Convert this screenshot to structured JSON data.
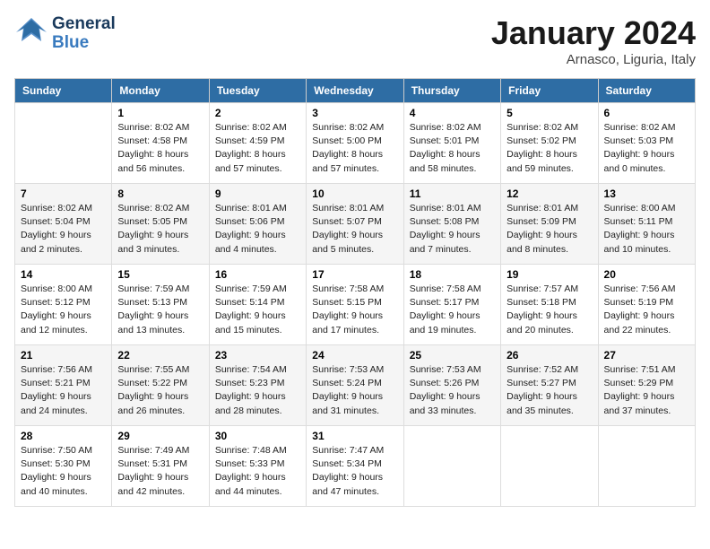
{
  "header": {
    "logo": {
      "general": "General",
      "blue": "Blue"
    },
    "title": "January 2024",
    "subtitle": "Arnasco, Liguria, Italy"
  },
  "columns": [
    "Sunday",
    "Monday",
    "Tuesday",
    "Wednesday",
    "Thursday",
    "Friday",
    "Saturday"
  ],
  "weeks": [
    [
      {
        "day": "",
        "info": ""
      },
      {
        "day": "1",
        "info": "Sunrise: 8:02 AM\nSunset: 4:58 PM\nDaylight: 8 hours\nand 56 minutes."
      },
      {
        "day": "2",
        "info": "Sunrise: 8:02 AM\nSunset: 4:59 PM\nDaylight: 8 hours\nand 57 minutes."
      },
      {
        "day": "3",
        "info": "Sunrise: 8:02 AM\nSunset: 5:00 PM\nDaylight: 8 hours\nand 57 minutes."
      },
      {
        "day": "4",
        "info": "Sunrise: 8:02 AM\nSunset: 5:01 PM\nDaylight: 8 hours\nand 58 minutes."
      },
      {
        "day": "5",
        "info": "Sunrise: 8:02 AM\nSunset: 5:02 PM\nDaylight: 8 hours\nand 59 minutes."
      },
      {
        "day": "6",
        "info": "Sunrise: 8:02 AM\nSunset: 5:03 PM\nDaylight: 9 hours\nand 0 minutes."
      }
    ],
    [
      {
        "day": "7",
        "info": "Sunrise: 8:02 AM\nSunset: 5:04 PM\nDaylight: 9 hours\nand 2 minutes."
      },
      {
        "day": "8",
        "info": "Sunrise: 8:02 AM\nSunset: 5:05 PM\nDaylight: 9 hours\nand 3 minutes."
      },
      {
        "day": "9",
        "info": "Sunrise: 8:01 AM\nSunset: 5:06 PM\nDaylight: 9 hours\nand 4 minutes."
      },
      {
        "day": "10",
        "info": "Sunrise: 8:01 AM\nSunset: 5:07 PM\nDaylight: 9 hours\nand 5 minutes."
      },
      {
        "day": "11",
        "info": "Sunrise: 8:01 AM\nSunset: 5:08 PM\nDaylight: 9 hours\nand 7 minutes."
      },
      {
        "day": "12",
        "info": "Sunrise: 8:01 AM\nSunset: 5:09 PM\nDaylight: 9 hours\nand 8 minutes."
      },
      {
        "day": "13",
        "info": "Sunrise: 8:00 AM\nSunset: 5:11 PM\nDaylight: 9 hours\nand 10 minutes."
      }
    ],
    [
      {
        "day": "14",
        "info": "Sunrise: 8:00 AM\nSunset: 5:12 PM\nDaylight: 9 hours\nand 12 minutes."
      },
      {
        "day": "15",
        "info": "Sunrise: 7:59 AM\nSunset: 5:13 PM\nDaylight: 9 hours\nand 13 minutes."
      },
      {
        "day": "16",
        "info": "Sunrise: 7:59 AM\nSunset: 5:14 PM\nDaylight: 9 hours\nand 15 minutes."
      },
      {
        "day": "17",
        "info": "Sunrise: 7:58 AM\nSunset: 5:15 PM\nDaylight: 9 hours\nand 17 minutes."
      },
      {
        "day": "18",
        "info": "Sunrise: 7:58 AM\nSunset: 5:17 PM\nDaylight: 9 hours\nand 19 minutes."
      },
      {
        "day": "19",
        "info": "Sunrise: 7:57 AM\nSunset: 5:18 PM\nDaylight: 9 hours\nand 20 minutes."
      },
      {
        "day": "20",
        "info": "Sunrise: 7:56 AM\nSunset: 5:19 PM\nDaylight: 9 hours\nand 22 minutes."
      }
    ],
    [
      {
        "day": "21",
        "info": "Sunrise: 7:56 AM\nSunset: 5:21 PM\nDaylight: 9 hours\nand 24 minutes."
      },
      {
        "day": "22",
        "info": "Sunrise: 7:55 AM\nSunset: 5:22 PM\nDaylight: 9 hours\nand 26 minutes."
      },
      {
        "day": "23",
        "info": "Sunrise: 7:54 AM\nSunset: 5:23 PM\nDaylight: 9 hours\nand 28 minutes."
      },
      {
        "day": "24",
        "info": "Sunrise: 7:53 AM\nSunset: 5:24 PM\nDaylight: 9 hours\nand 31 minutes."
      },
      {
        "day": "25",
        "info": "Sunrise: 7:53 AM\nSunset: 5:26 PM\nDaylight: 9 hours\nand 33 minutes."
      },
      {
        "day": "26",
        "info": "Sunrise: 7:52 AM\nSunset: 5:27 PM\nDaylight: 9 hours\nand 35 minutes."
      },
      {
        "day": "27",
        "info": "Sunrise: 7:51 AM\nSunset: 5:29 PM\nDaylight: 9 hours\nand 37 minutes."
      }
    ],
    [
      {
        "day": "28",
        "info": "Sunrise: 7:50 AM\nSunset: 5:30 PM\nDaylight: 9 hours\nand 40 minutes."
      },
      {
        "day": "29",
        "info": "Sunrise: 7:49 AM\nSunset: 5:31 PM\nDaylight: 9 hours\nand 42 minutes."
      },
      {
        "day": "30",
        "info": "Sunrise: 7:48 AM\nSunset: 5:33 PM\nDaylight: 9 hours\nand 44 minutes."
      },
      {
        "day": "31",
        "info": "Sunrise: 7:47 AM\nSunset: 5:34 PM\nDaylight: 9 hours\nand 47 minutes."
      },
      {
        "day": "",
        "info": ""
      },
      {
        "day": "",
        "info": ""
      },
      {
        "day": "",
        "info": ""
      }
    ]
  ]
}
